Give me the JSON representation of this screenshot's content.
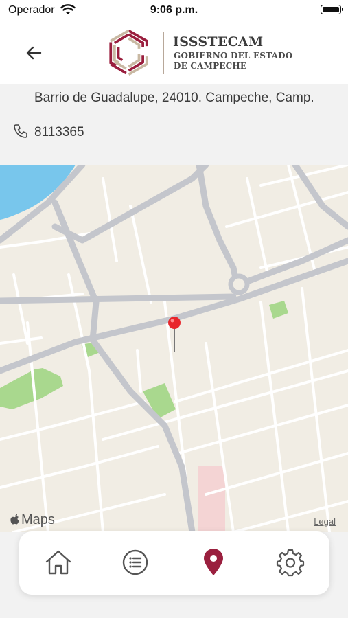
{
  "status_bar": {
    "carrier": "Operador",
    "time": "9:06 p.m."
  },
  "header": {
    "back_icon": "arrow-left-icon",
    "logo": {
      "title": "ISSSTECAM",
      "subtitle_line1": "GOBIERNO DEL ESTADO",
      "subtitle_line2": "DE CAMPECHE",
      "colors": {
        "maroon": "#9a1f3e",
        "tan": "#c9b9a3"
      }
    }
  },
  "location": {
    "address_line": "Barrio de Guadalupe, 24010. Campeche, Camp.",
    "phone": "8113365",
    "phone_icon": "phone-icon"
  },
  "map": {
    "attribution": "Maps",
    "legal_label": "Legal",
    "pin_color": "#e8262b",
    "colors": {
      "land": "#f1ede4",
      "road": "#ffffff",
      "major_road": "#c4c6cc",
      "water": "#78c6ec",
      "park": "#a9d88e"
    }
  },
  "bottom_nav": {
    "items": [
      {
        "name": "home",
        "icon": "home-icon",
        "active": false
      },
      {
        "name": "list",
        "icon": "list-icon",
        "active": false
      },
      {
        "name": "location",
        "icon": "location-pin-icon",
        "active": true
      },
      {
        "name": "settings",
        "icon": "gear-icon",
        "active": false
      }
    ],
    "active_color": "#9a1f3e",
    "inactive_color": "#555555"
  }
}
